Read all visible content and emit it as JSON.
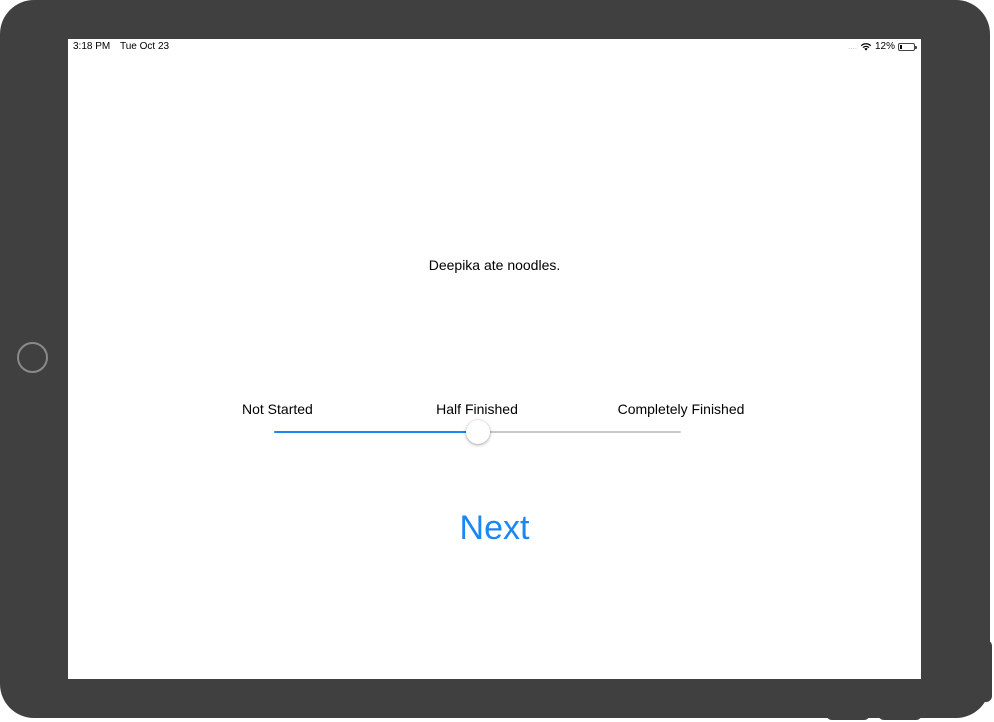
{
  "status_bar": {
    "time": "3:18 PM",
    "date": "Tue Oct 23",
    "signal_dots": "....",
    "battery_percent": "12%",
    "battery_level": 0.12
  },
  "main": {
    "sentence": "Deepika ate noodles.",
    "progress_labels": [
      "Not Started",
      "Half Finished",
      "Completely Finished"
    ],
    "slider_value": 0.5,
    "next_label": "Next"
  },
  "colors": {
    "accent": "#1b87f0",
    "device_frame": "#404040"
  },
  "icons": {
    "wifi": "wifi-icon",
    "battery": "battery-icon",
    "home": "home-button"
  }
}
